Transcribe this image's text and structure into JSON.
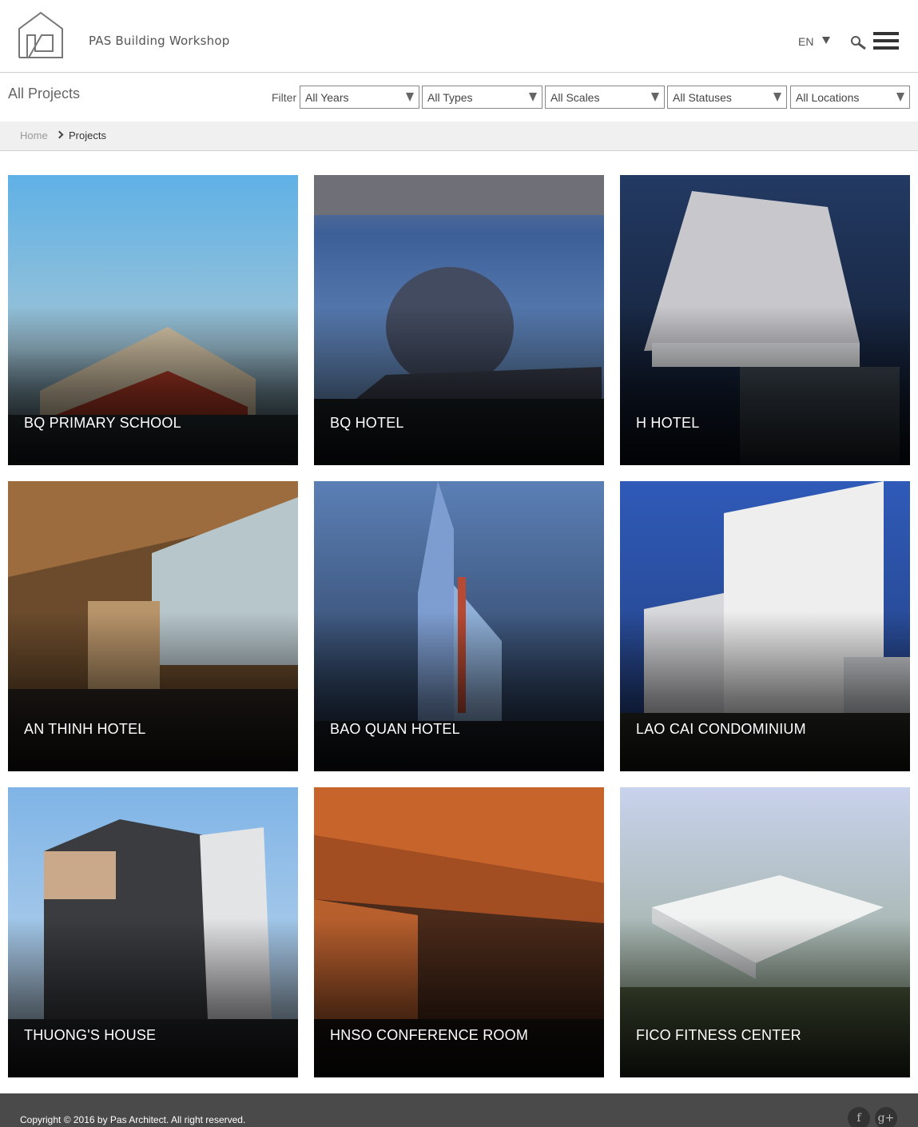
{
  "header": {
    "brand": "PAS Building Workshop",
    "language": "EN"
  },
  "filters": {
    "page_title": "All Projects",
    "label": "Filter",
    "selects": [
      "All Years",
      "All Types",
      "All Scales",
      "All Statuses",
      "All Locations"
    ]
  },
  "breadcrumb": {
    "home": "Home",
    "current": "Projects"
  },
  "projects": [
    {
      "title": "BQ PRIMARY SCHOOL"
    },
    {
      "title": "BQ HOTEL"
    },
    {
      "title": "H HOTEL"
    },
    {
      "title": "AN THINH HOTEL"
    },
    {
      "title": "BAO QUAN HOTEL"
    },
    {
      "title": "LAO CAI CONDOMINIUM"
    },
    {
      "title": "THUONG'S HOUSE"
    },
    {
      "title": "HNSO CONFERENCE ROOM"
    },
    {
      "title": "FICO FITNESS CENTER"
    }
  ],
  "footer": {
    "copyright": "Copyright © 2016 by Pas Architect. All right reserved.",
    "social_icons": [
      "facebook-icon",
      "google-plus-icon"
    ]
  }
}
